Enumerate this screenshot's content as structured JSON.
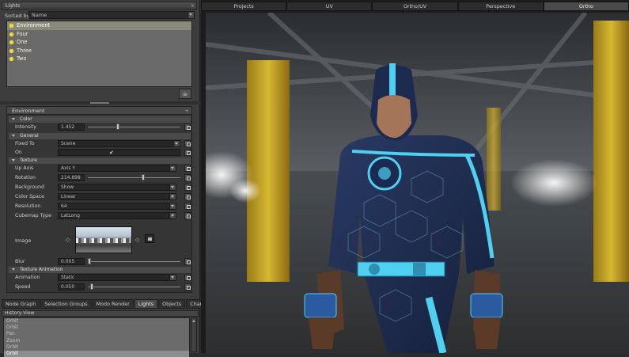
{
  "lights_panel": {
    "title": "Lights",
    "close": "x",
    "sorted_by_label": "Sorted by",
    "sorted_by_value": "Name",
    "items": [
      "Environment",
      "Four",
      "One",
      "Three",
      "Two"
    ],
    "selected": "Environment"
  },
  "props": {
    "header": "Environment",
    "sections": {
      "color": "Color",
      "general": "General",
      "texture": "Texture",
      "texture_anim": "Texture Animation"
    },
    "intensity": {
      "label": "Intensity",
      "value": "1.452",
      "slider_fraction": 0.32
    },
    "fixed_to": {
      "label": "Fixed To",
      "value": "Scene"
    },
    "on": {
      "label": "On",
      "value": "✔"
    },
    "up_axis": {
      "label": "Up Axis",
      "value": "Axis Y"
    },
    "rotation": {
      "label": "Rotation",
      "value": "214.898",
      "slider_fraction": 0.6
    },
    "background": {
      "label": "Background",
      "value": "Show"
    },
    "color_space": {
      "label": "Color Space",
      "value": "Linear"
    },
    "resolution": {
      "label": "Resolution",
      "value": "64"
    },
    "cubemap_type": {
      "label": "Cubemap Type",
      "value": "LatLong"
    },
    "image": {
      "label": "Image"
    },
    "blur": {
      "label": "Blur",
      "value": "0.005",
      "slider_fraction": 0.0
    },
    "animation": {
      "label": "Animation",
      "value": "Static"
    },
    "speed": {
      "label": "Speed",
      "value": "0.050",
      "slider_fraction": 0.03
    }
  },
  "bottom_tabs": [
    "Node Graph",
    "Selection Groups",
    "Modo Render",
    "Lights",
    "Objects",
    "Channels"
  ],
  "active_bottom_tab": "Lights",
  "history": {
    "title": "History View",
    "items": [
      "Orbit",
      "Orbit",
      "Pan",
      "Zoom",
      "Orbit",
      "Orbit"
    ]
  },
  "viewport_tabs": [
    "Projects",
    "UV",
    "Ortho/UV",
    "Perspective",
    "Ortho"
  ],
  "active_viewport_tab": "Ortho",
  "colors": {
    "accent_cyan": "#4fd0f0",
    "suit_navy": "#1d2c4e",
    "pillar_yellow": "#d8b830"
  }
}
